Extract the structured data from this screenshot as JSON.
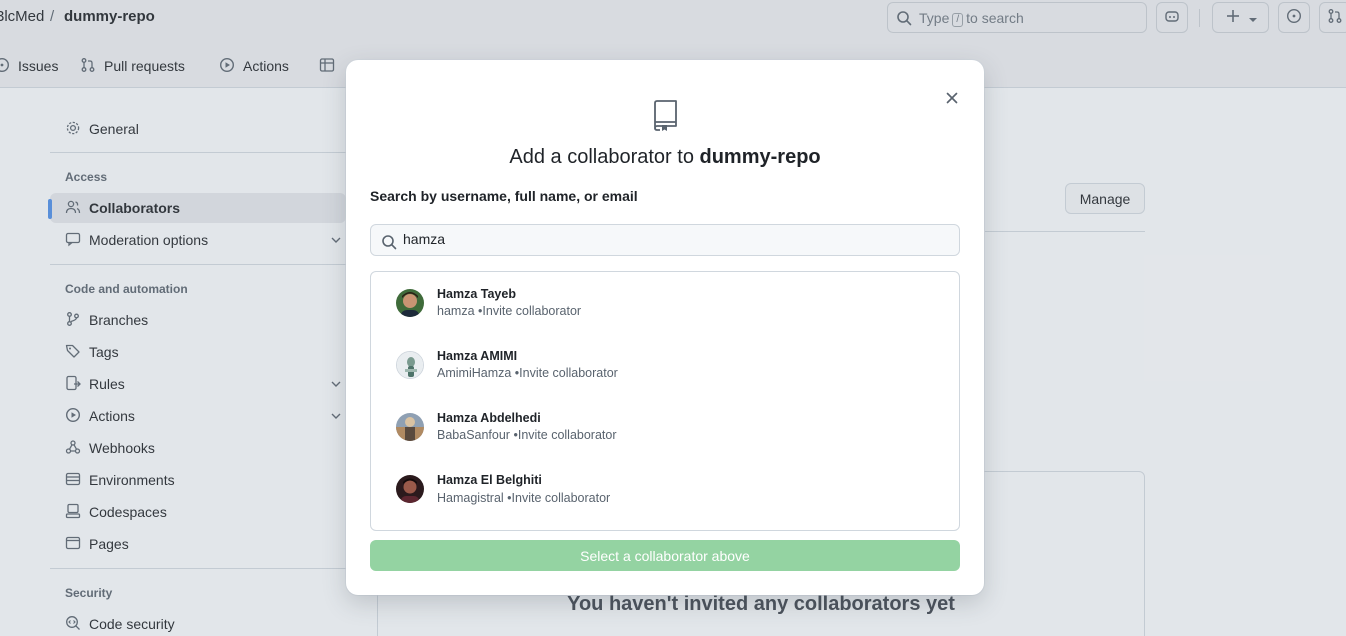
{
  "header": {
    "owner": "3lcMed",
    "separator": "/",
    "repo": "dummy-repo",
    "search_prefix": "Type",
    "search_key": "/",
    "search_suffix": "to search"
  },
  "tabs": [
    {
      "label": "Issues",
      "icon": "issue-icon"
    },
    {
      "label": "Pull requests",
      "icon": "pull-request-icon"
    },
    {
      "label": "Actions",
      "icon": "play-icon"
    }
  ],
  "sidebar": {
    "general": "General",
    "access_heading": "Access",
    "collaborators": "Collaborators",
    "moderation": "Moderation options",
    "code_heading": "Code and automation",
    "branches": "Branches",
    "tags": "Tags",
    "rules": "Rules",
    "actions": "Actions",
    "webhooks": "Webhooks",
    "environments": "Environments",
    "codespaces": "Codespaces",
    "pages": "Pages",
    "security_heading": "Security",
    "code_security": "Code security"
  },
  "main": {
    "manage_label": "Manage",
    "empty_text": "You haven't invited any collaborators yet"
  },
  "modal": {
    "title_prefix": "Add a collaborator to",
    "title_repo": "dummy-repo",
    "search_label": "Search by username, full name, or email",
    "search_value": "hamza",
    "results": [
      {
        "name": "Hamza Tayeb",
        "login": "hamza",
        "action": "•Invite collaborator"
      },
      {
        "name": "Hamza AMIMI",
        "login": "AmimiHamza",
        "action": "•Invite collaborator"
      },
      {
        "name": "Hamza Abdelhedi",
        "login": "BabaSanfour",
        "action": "•Invite collaborator"
      },
      {
        "name": "Hamza El Belghiti",
        "login": "Hamagistral",
        "action": "•Invite collaborator"
      }
    ],
    "submit_label": "Select a collaborator above"
  },
  "colors": {
    "accent": "#0969da",
    "disabled_green": "#94d3a2",
    "active_indicator": "#0969da"
  }
}
